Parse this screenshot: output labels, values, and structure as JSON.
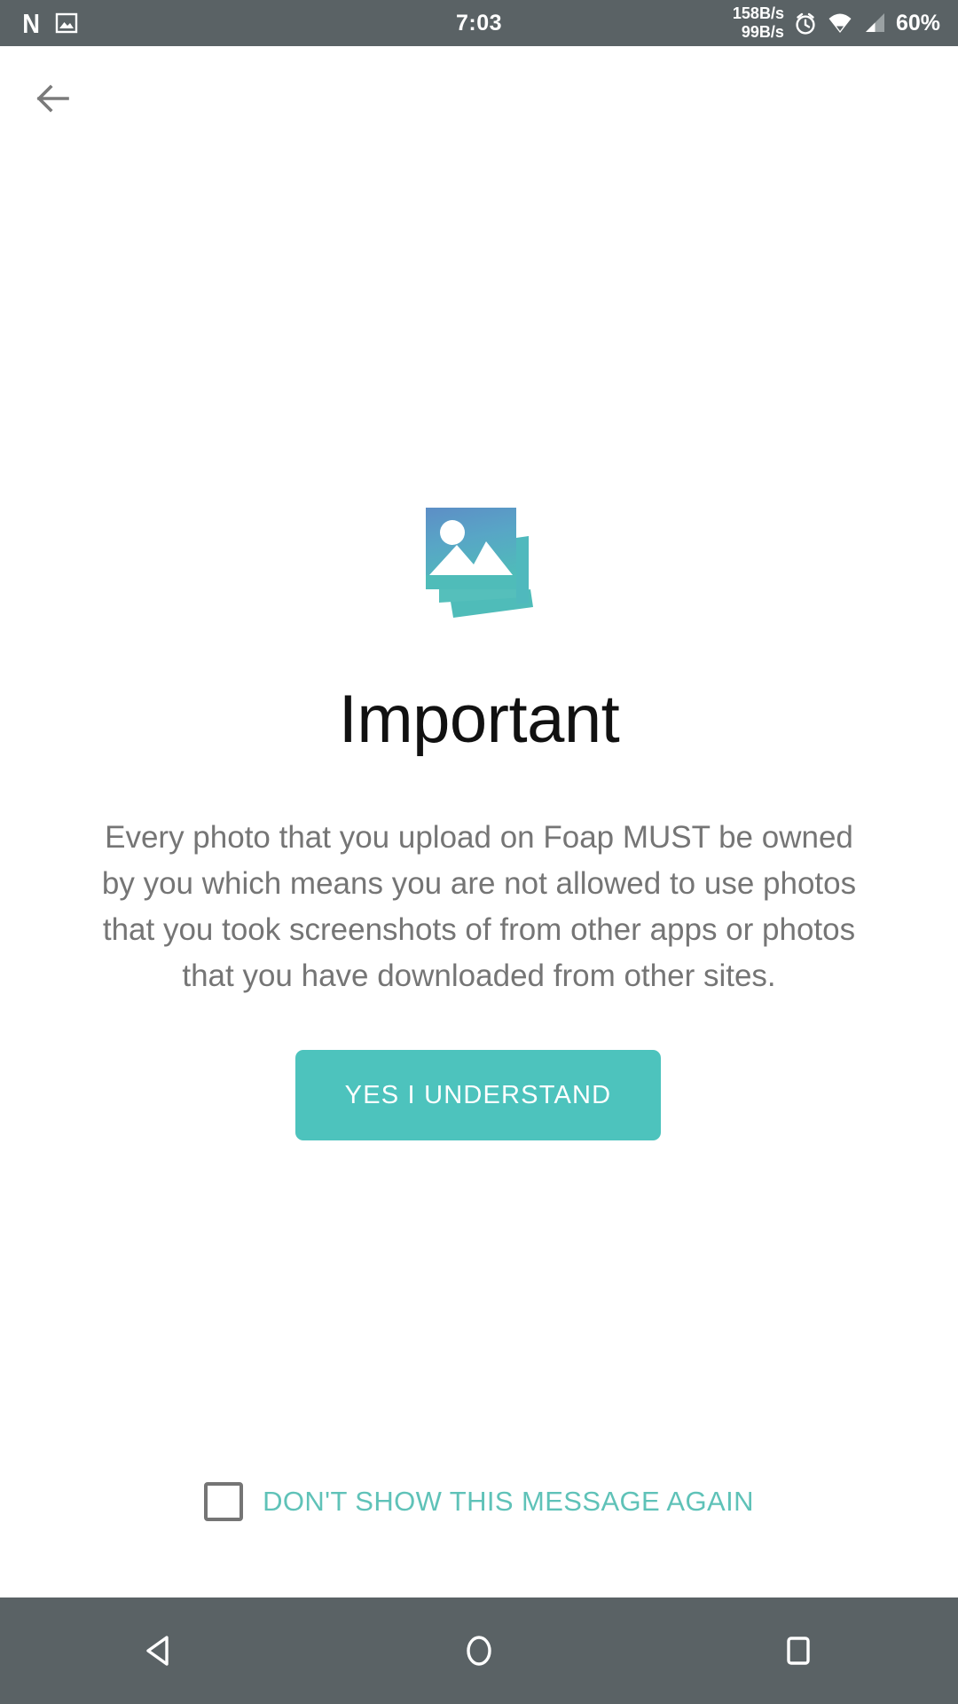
{
  "status_bar": {
    "app_icon_left": "netflix-n-logo",
    "photo_notification_icon": "photo-icon",
    "time": "7:03",
    "network_speed_down": "158B/s",
    "network_speed_up": "99B/s",
    "alarm_icon": "alarm-clock-icon",
    "wifi_icon": "wifi-icon",
    "signal_icon": "cellular-signal-icon",
    "battery": "60%",
    "background_color": "#5a6265"
  },
  "app_bar": {
    "back_label": "back-arrow",
    "back_icon_color": "#7a7a7a"
  },
  "main": {
    "hero_icon": "photo-stack-icon",
    "title": "Important",
    "body": "Every photo that you upload on Foap MUST be owned by you which means you are not allowed to use photos that you took screenshots of from other apps or photos that you have downloaded from other sites.",
    "primary_button": "YES I UNDERSTAND",
    "checkbox_label": "DON'T SHOW THIS MESSAGE AGAIN",
    "checkbox_checked": false,
    "accent_color": "#4dc3bd",
    "link_color": "#5fc2b8",
    "title_color": "#111111",
    "body_color": "#757575"
  },
  "nav_bar": {
    "back": "nav-back-triangle",
    "home": "nav-home-circle",
    "recents": "nav-recents-square",
    "background_color": "#5a6265"
  }
}
